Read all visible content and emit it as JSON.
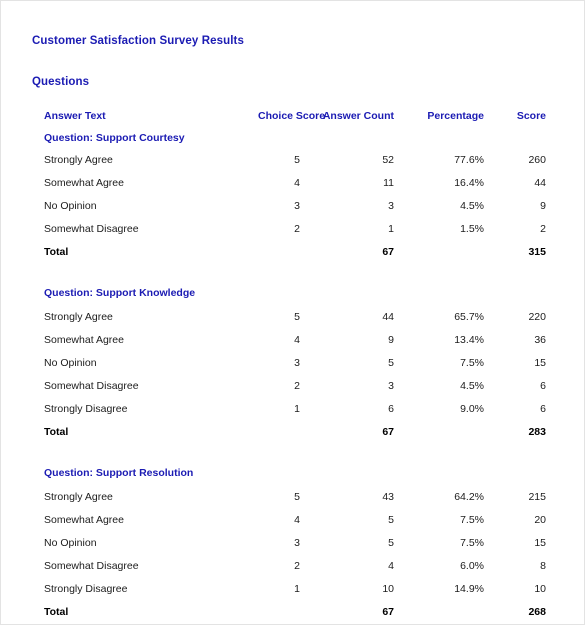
{
  "report": {
    "title": "Customer Satisfaction Survey Results",
    "section_heading": "Questions"
  },
  "accent_color": "#1b1bb3",
  "table": {
    "columns": [
      {
        "key": "answer_text",
        "label": "Answer Text",
        "align": "left"
      },
      {
        "key": "choice_score",
        "label": "Choice Score",
        "align": "right"
      },
      {
        "key": "answer_count",
        "label": "Answer Count",
        "align": "right"
      },
      {
        "key": "percentage",
        "label": "Percentage",
        "align": "right"
      },
      {
        "key": "score",
        "label": "Score",
        "align": "right"
      }
    ],
    "total_label": "Total",
    "groups": [
      {
        "heading": "Question: Support Courtesy",
        "rows": [
          {
            "answer_text": "Strongly Agree",
            "choice_score": "5",
            "answer_count": "52",
            "percentage": "77.6%",
            "score": "260"
          },
          {
            "answer_text": "Somewhat Agree",
            "choice_score": "4",
            "answer_count": "11",
            "percentage": "16.4%",
            "score": "44"
          },
          {
            "answer_text": "No Opinion",
            "choice_score": "3",
            "answer_count": "3",
            "percentage": "4.5%",
            "score": "9"
          },
          {
            "answer_text": "Somewhat Disagree",
            "choice_score": "2",
            "answer_count": "1",
            "percentage": "1.5%",
            "score": "2"
          }
        ],
        "total": {
          "answer_count": "67",
          "score": "315"
        }
      },
      {
        "heading": "Question: Support Knowledge",
        "rows": [
          {
            "answer_text": "Strongly Agree",
            "choice_score": "5",
            "answer_count": "44",
            "percentage": "65.7%",
            "score": "220"
          },
          {
            "answer_text": "Somewhat Agree",
            "choice_score": "4",
            "answer_count": "9",
            "percentage": "13.4%",
            "score": "36"
          },
          {
            "answer_text": "No Opinion",
            "choice_score": "3",
            "answer_count": "5",
            "percentage": "7.5%",
            "score": "15"
          },
          {
            "answer_text": "Somewhat Disagree",
            "choice_score": "2",
            "answer_count": "3",
            "percentage": "4.5%",
            "score": "6"
          },
          {
            "answer_text": "Strongly Disagree",
            "choice_score": "1",
            "answer_count": "6",
            "percentage": "9.0%",
            "score": "6"
          }
        ],
        "total": {
          "answer_count": "67",
          "score": "283"
        }
      },
      {
        "heading": "Question: Support Resolution",
        "rows": [
          {
            "answer_text": "Strongly Agree",
            "choice_score": "5",
            "answer_count": "43",
            "percentage": "64.2%",
            "score": "215"
          },
          {
            "answer_text": "Somewhat Agree",
            "choice_score": "4",
            "answer_count": "5",
            "percentage": "7.5%",
            "score": "20"
          },
          {
            "answer_text": "No Opinion",
            "choice_score": "3",
            "answer_count": "5",
            "percentage": "7.5%",
            "score": "15"
          },
          {
            "answer_text": "Somewhat Disagree",
            "choice_score": "2",
            "answer_count": "4",
            "percentage": "6.0%",
            "score": "8"
          },
          {
            "answer_text": "Strongly Disagree",
            "choice_score": "1",
            "answer_count": "10",
            "percentage": "14.9%",
            "score": "10"
          }
        ],
        "total": {
          "answer_count": "67",
          "score": "268"
        }
      }
    ]
  }
}
